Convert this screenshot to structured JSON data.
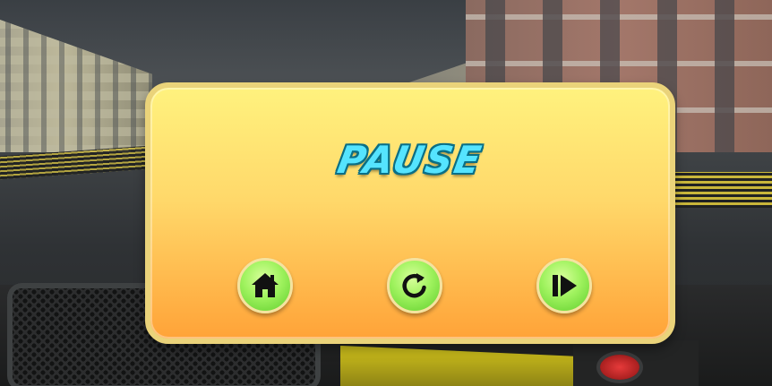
{
  "pause_dialog": {
    "title": "PAUSE",
    "buttons": [
      {
        "id": "home",
        "icon": "home-icon"
      },
      {
        "id": "restart",
        "icon": "restart-icon"
      },
      {
        "id": "resume",
        "icon": "resume-icon"
      }
    ]
  },
  "colors": {
    "title": "#55e4ff",
    "title_outline": "#0a6f86",
    "dialog_top": "#fff27e",
    "dialog_bottom": "#ffa338",
    "button_green": "#9ff25e",
    "icon": "#111111"
  }
}
